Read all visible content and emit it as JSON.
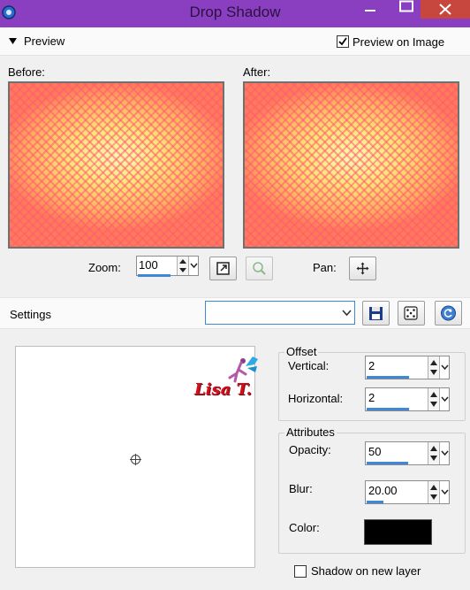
{
  "window": {
    "title": "Drop Shadow"
  },
  "preview": {
    "section_label": "Preview",
    "preview_on_image_label": "Preview on Image",
    "preview_on_image_checked": true,
    "before_label": "Before:",
    "after_label": "After:"
  },
  "zoom": {
    "label": "Zoom:",
    "value": "100",
    "pan_label": "Pan:"
  },
  "settings": {
    "label": "Settings",
    "preset_value": ""
  },
  "watermark": {
    "text": "Lisa T."
  },
  "offset": {
    "group_label": "Offset",
    "vertical_label": "Vertical:",
    "vertical_value": "2",
    "horizontal_label": "Horizontal:",
    "horizontal_value": "2"
  },
  "attributes": {
    "group_label": "Attributes",
    "opacity_label": "Opacity:",
    "opacity_value": "50",
    "blur_label": "Blur:",
    "blur_value": "20.00",
    "color_label": "Color:",
    "color_value": "#000000"
  },
  "shadow_new_layer": {
    "label": "Shadow on new layer",
    "checked": false
  },
  "colors": {
    "titlebar": "#8a3fc0",
    "close_button": "#c7463e",
    "accent": "#3f88d6"
  }
}
